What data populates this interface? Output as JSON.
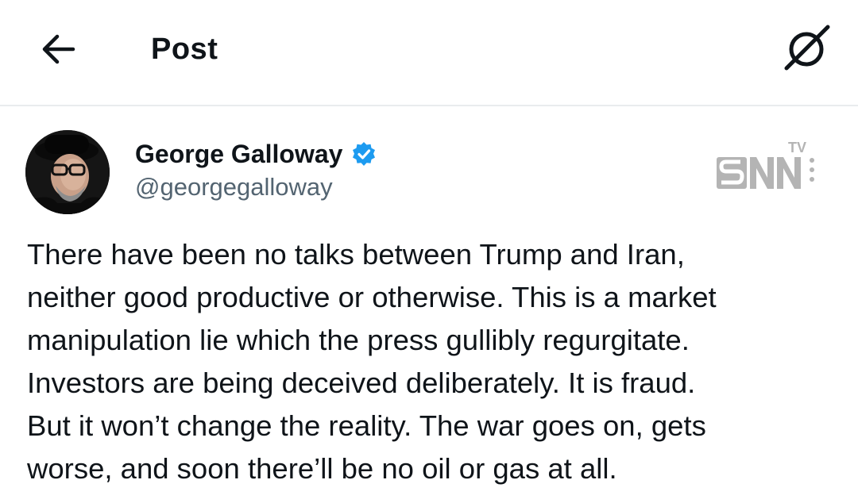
{
  "header": {
    "title": "Post",
    "back_icon": "arrow-left-icon",
    "grok_icon": "grok-slash-circle-icon"
  },
  "post": {
    "author": {
      "name": "George Galloway",
      "handle": "@georgegalloway",
      "verified": true,
      "verified_color": "#1d9bf0"
    },
    "text_lines": [
      "There have been no talks between Trump and Iran,",
      "neither good productive or otherwise. This is a market",
      "manipulation lie which the press gullibly regurgitate.",
      "Investors are being deceived deliberately. It is fraud.",
      "But it won’t change the reality. The war goes on, gets",
      "worse, and soon there’ll be no oil or gas at all."
    ]
  },
  "watermark": {
    "brand": "SNN",
    "superscript": "TV"
  },
  "colors": {
    "text": "#0f1419",
    "secondary": "#536471",
    "divider": "#e9ecee",
    "watermark": "#b4b4b4"
  }
}
